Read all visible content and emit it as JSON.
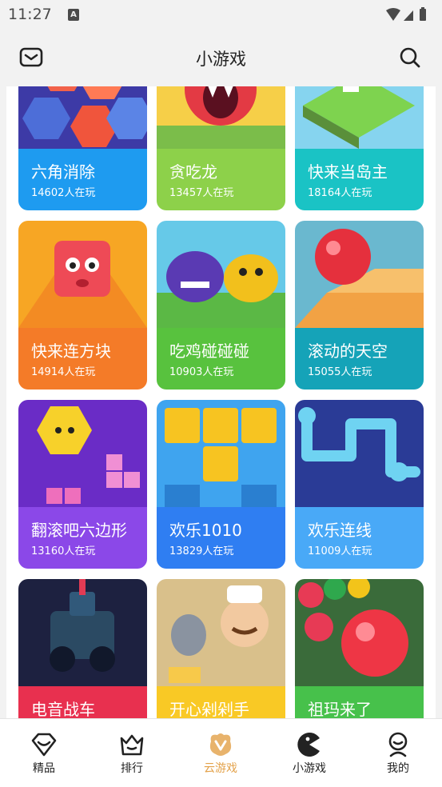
{
  "status_bar": {
    "time": "11:27",
    "notification_glyph": "A"
  },
  "header": {
    "title": "小游戏"
  },
  "games": [
    {
      "name": "六角消除",
      "players": "14602人在玩",
      "color": "#1e9bf0",
      "art": "hex"
    },
    {
      "name": "贪吃龙",
      "players": "13457人在玩",
      "color": "#8dd14a",
      "art": "dragon"
    },
    {
      "name": "快来当岛主",
      "players": "18164人在玩",
      "color": "#1ac3c5",
      "art": "island"
    },
    {
      "name": "快来连方块",
      "players": "14914人在玩",
      "color": "#f47b28",
      "art": "block"
    },
    {
      "name": "吃鸡碰碰碰",
      "players": "10903人在玩",
      "color": "#58c23e",
      "art": "blobs"
    },
    {
      "name": "滚动的天空",
      "players": "15055人在玩",
      "color": "#15a3b8",
      "art": "ball"
    },
    {
      "name": "翻滚吧六边形",
      "players": "13160人在玩",
      "color": "#8b48e8",
      "art": "hexdog"
    },
    {
      "name": "欢乐1010",
      "players": "13829人在玩",
      "color": "#2f7ef2",
      "art": "tiles"
    },
    {
      "name": "欢乐连线",
      "players": "11009人在玩",
      "color": "#49a9f7",
      "art": "pipes"
    },
    {
      "name": "电音战车",
      "players": "",
      "color": "#e8304f",
      "art": "tank"
    },
    {
      "name": "开心剁剁手",
      "players": "",
      "color": "#f9c925",
      "art": "chef"
    },
    {
      "name": "祖玛来了",
      "players": "",
      "color": "#47c14b",
      "art": "zuma"
    }
  ],
  "tabs": [
    {
      "label": "精品",
      "icon": "diamond-icon",
      "active": false
    },
    {
      "label": "排行",
      "icon": "crown-icon",
      "active": false
    },
    {
      "label": "云游戏",
      "icon": "cloud-game-icon",
      "active": true
    },
    {
      "label": "小游戏",
      "icon": "pacman-icon",
      "active": false
    },
    {
      "label": "我的",
      "icon": "profile-icon",
      "active": false
    }
  ],
  "colors": {
    "accent": "#e3a24a",
    "background": "#f2f2f2"
  }
}
